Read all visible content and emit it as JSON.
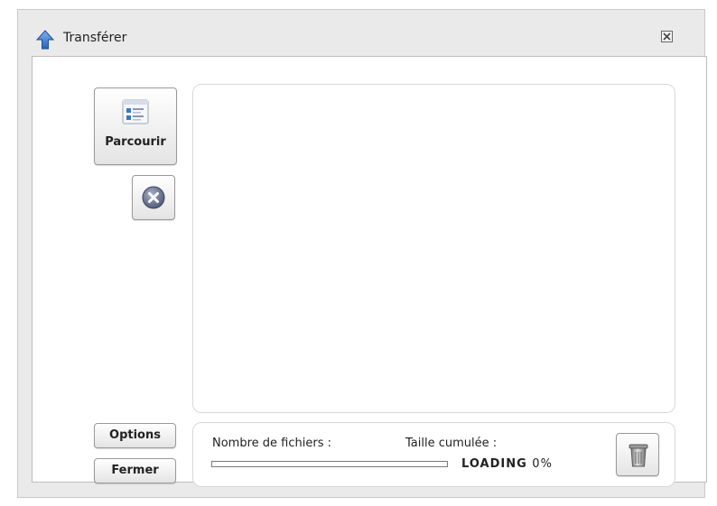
{
  "window": {
    "title": "Transférer",
    "title_icon": "up-arrow-icon",
    "close_icon": "close-icon"
  },
  "toolbar": {
    "browse_label": "Parcourir",
    "browse_icon": "file-list-icon",
    "remove_icon": "remove-circle-icon",
    "options_label": "Options",
    "close_label": "Fermer"
  },
  "status": {
    "files_label": "Nombre de fichiers :",
    "size_label": "Taille cumulée :",
    "loading_label": "LOADING",
    "loading_percent": "0%",
    "progress": 0,
    "trash_icon": "trash-icon"
  },
  "colors": {
    "panel_bg": "#ffffff",
    "window_bg": "#eaeaea",
    "accent": "#3a78c8"
  }
}
